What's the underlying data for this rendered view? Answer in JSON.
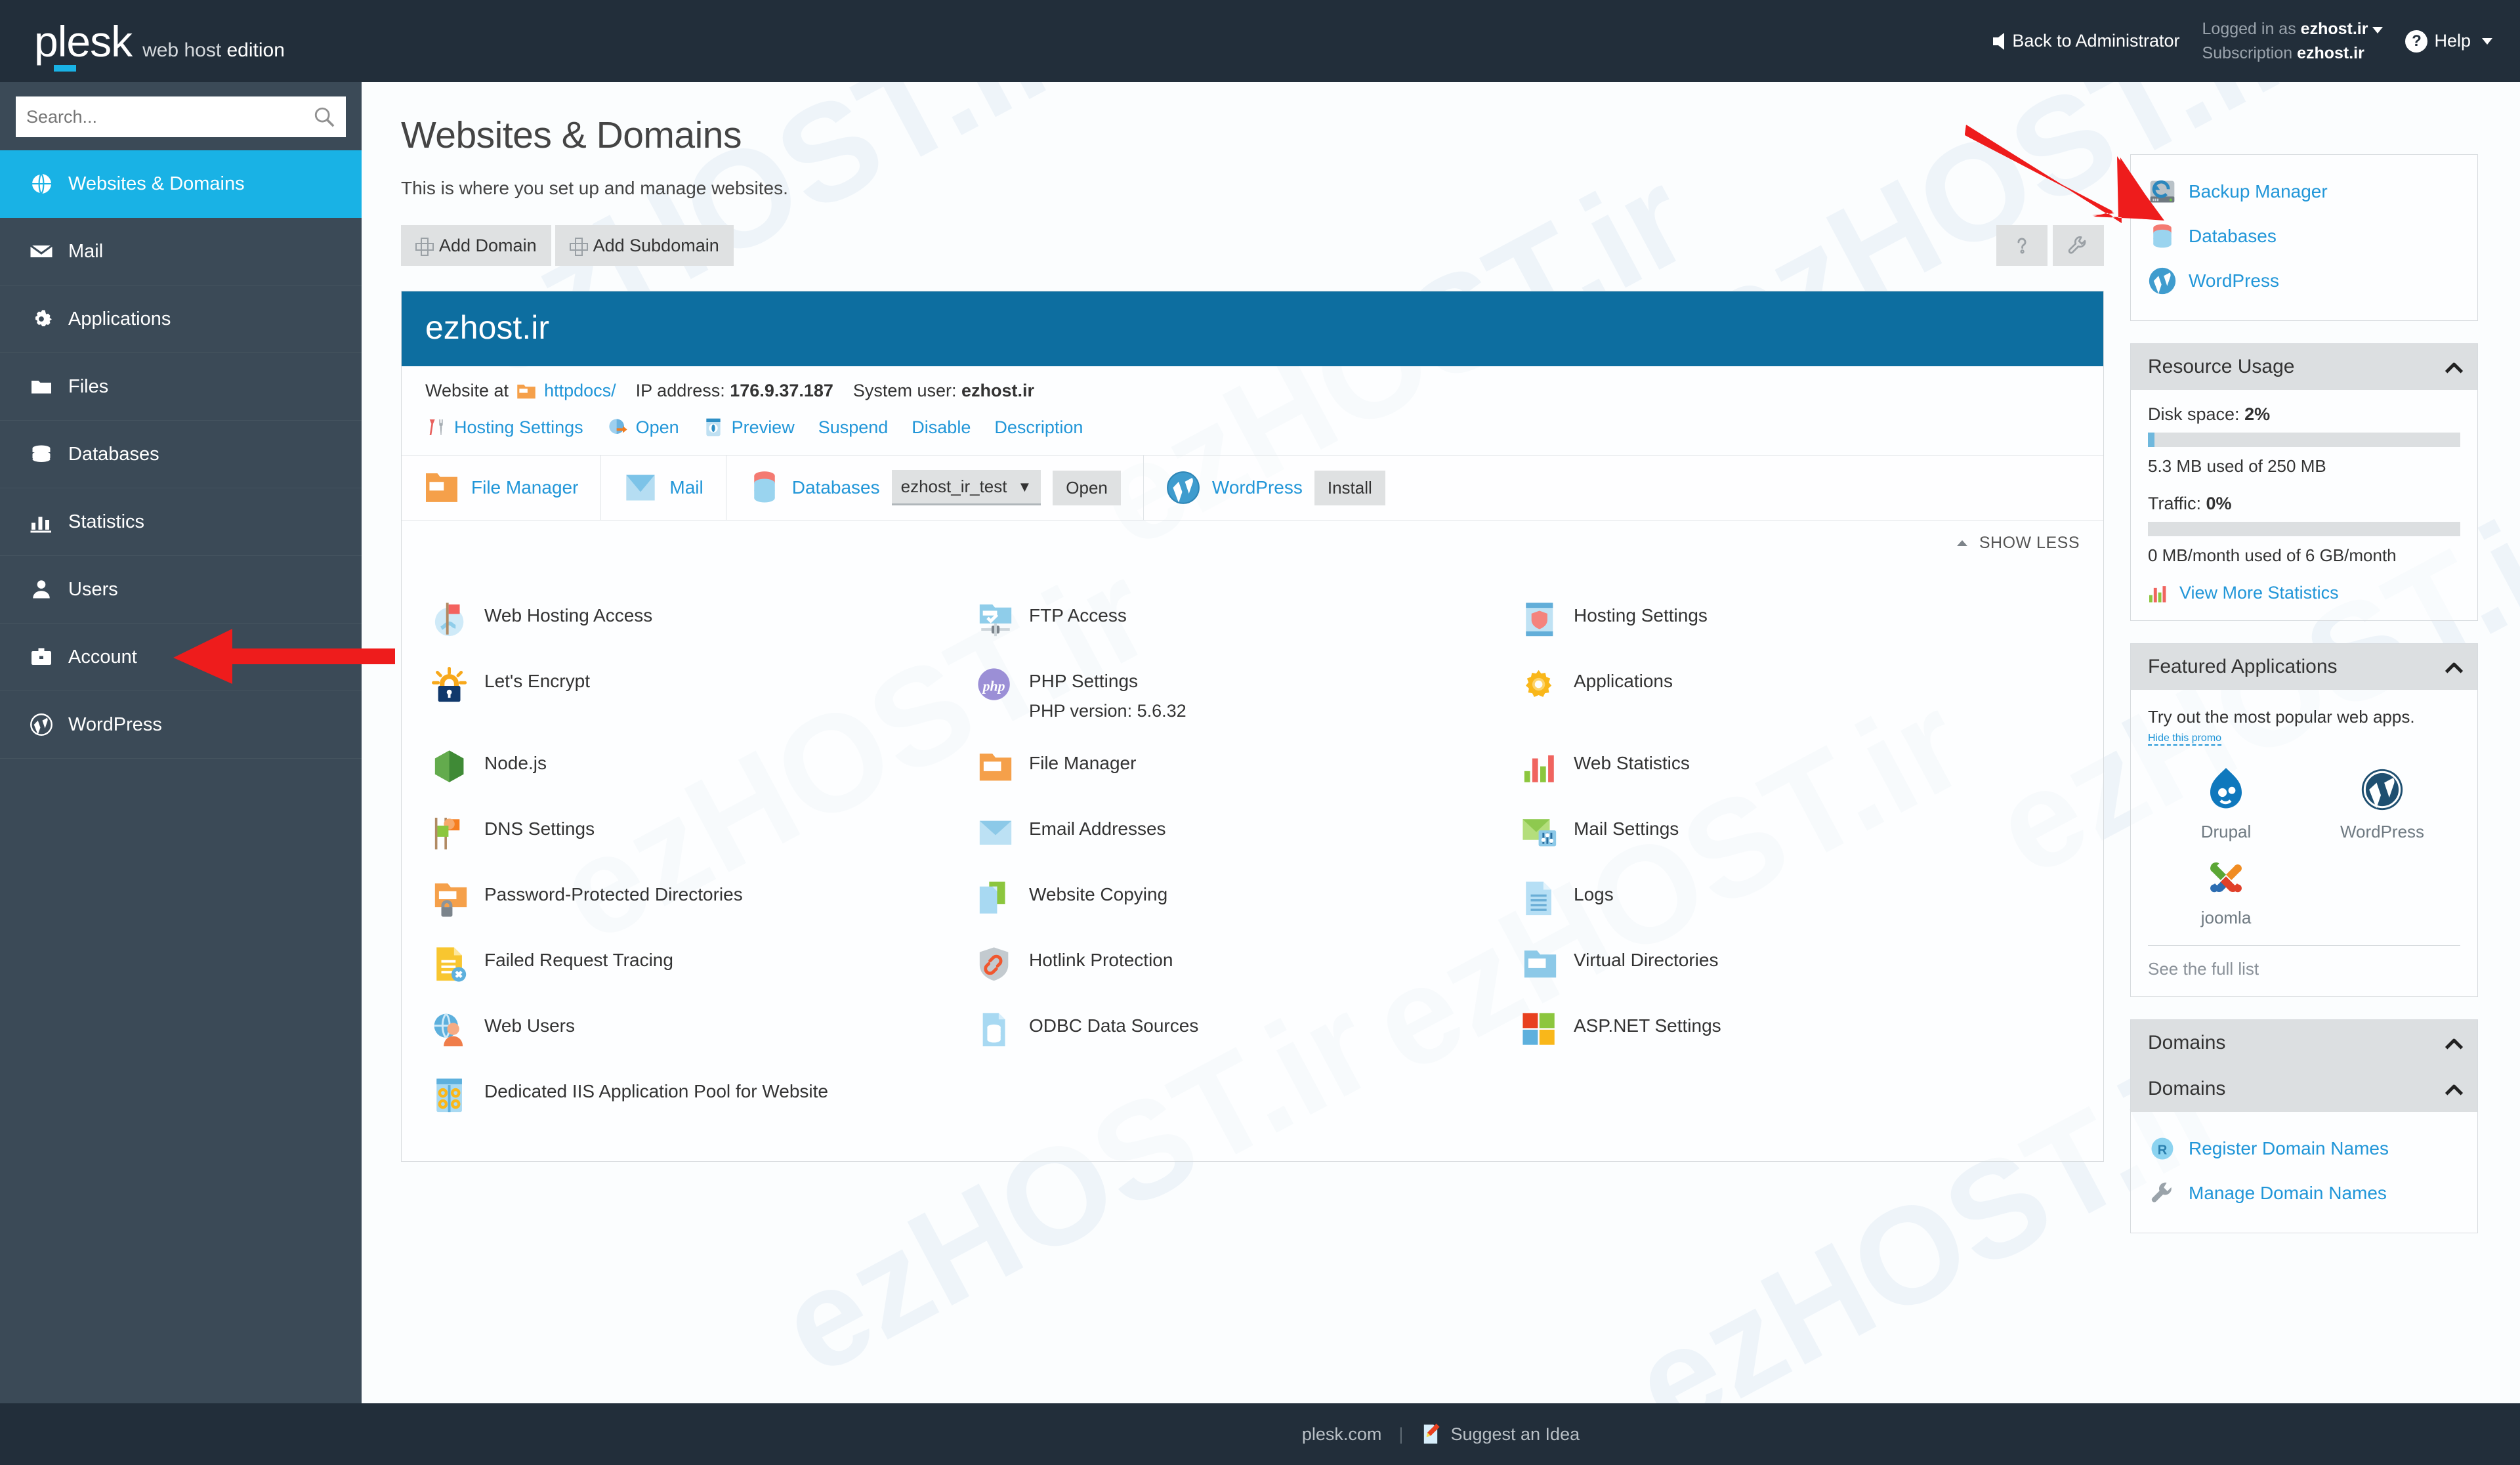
{
  "topbar": {
    "logo": "plesk",
    "logo_sub_1": "web host",
    "logo_sub_2": "edition",
    "back_to_admin": "Back to Administrator",
    "logged_in_label": "Logged in as",
    "logged_in_value": "ezhost.ir",
    "subscription_label": "Subscription",
    "subscription_value": "ezhost.ir",
    "help": "Help"
  },
  "sidebar": {
    "search_placeholder": "Search...",
    "items": [
      {
        "label": "Websites & Domains",
        "icon": "globe-icon",
        "active": true
      },
      {
        "label": "Mail",
        "icon": "envelope-icon",
        "active": false
      },
      {
        "label": "Applications",
        "icon": "gear-icon",
        "active": false
      },
      {
        "label": "Files",
        "icon": "folder-icon",
        "active": false
      },
      {
        "label": "Databases",
        "icon": "database-icon",
        "active": false
      },
      {
        "label": "Statistics",
        "icon": "bar-chart-icon",
        "active": false
      },
      {
        "label": "Users",
        "icon": "user-icon",
        "active": false
      },
      {
        "label": "Account",
        "icon": "briefcase-icon",
        "active": false
      },
      {
        "label": "WordPress",
        "icon": "wordpress-icon",
        "active": false
      }
    ]
  },
  "main": {
    "title": "Websites & Domains",
    "description": "This is where you set up and manage websites.",
    "add_domain": "Add Domain",
    "add_subdomain": "Add Subdomain",
    "help_button_icon": "question-mark-icon",
    "wrench_button_icon": "wrench-icon",
    "show_less": "SHOW LESS"
  },
  "domain": {
    "name": "ezhost.ir",
    "website_at_label": "Website at",
    "httpdocs": "httpdocs/",
    "ip_label": "IP address:",
    "ip_value": "176.9.37.187",
    "sysuser_label": "System user:",
    "sysuser_value": "ezhost.ir",
    "actions": [
      {
        "label": "Hosting Settings",
        "icon": "tools-icon",
        "link": true
      },
      {
        "label": "Open",
        "icon": "open-icon",
        "link": true
      },
      {
        "label": "Preview",
        "icon": "preview-icon",
        "link": true
      },
      {
        "label": "Suspend",
        "icon": "",
        "link": true
      },
      {
        "label": "Disable",
        "icon": "",
        "link": true
      },
      {
        "label": "Description",
        "icon": "",
        "link": true
      }
    ],
    "quick": {
      "file_manager": "File Manager",
      "mail": "Mail",
      "databases": "Databases",
      "db_selected": "ezhost_ir_test",
      "db_open": "Open",
      "wordpress": "WordPress",
      "wp_install": "Install"
    }
  },
  "grid": [
    {
      "label": "Web Hosting Access",
      "icon": "globe-flag-icon"
    },
    {
      "label": "FTP Access",
      "icon": "ftp-folder-icon"
    },
    {
      "label": "Hosting Settings",
      "icon": "shield-doc-icon"
    },
    {
      "label": "Let's Encrypt",
      "icon": "lock-sun-icon"
    },
    {
      "label": "PHP Settings",
      "icon": "php-icon",
      "note": "PHP version: 5.6.32"
    },
    {
      "label": "Applications",
      "icon": "gear-yellow-icon"
    },
    {
      "label": "Node.js",
      "icon": "nodejs-icon"
    },
    {
      "label": "File Manager",
      "icon": "folder-orange-icon"
    },
    {
      "label": "Web Statistics",
      "icon": "bars-icon"
    },
    {
      "label": "DNS Settings",
      "icon": "flags-icon"
    },
    {
      "label": "Email Addresses",
      "icon": "envelope-blue-icon"
    },
    {
      "label": "Mail Settings",
      "icon": "envelope-green-icon"
    },
    {
      "label": "Password-Protected Directories",
      "icon": "folder-lock-icon"
    },
    {
      "label": "Website Copying",
      "icon": "copy-icon"
    },
    {
      "label": "Logs",
      "icon": "log-doc-icon"
    },
    {
      "label": "Failed Request Tracing",
      "icon": "doc-error-icon"
    },
    {
      "label": "Hotlink Protection",
      "icon": "shield-link-icon"
    },
    {
      "label": "Virtual Directories",
      "icon": "folder-blue-icon"
    },
    {
      "label": "Web Users",
      "icon": "web-user-icon"
    },
    {
      "label": "ODBC Data Sources",
      "icon": "odbc-icon"
    },
    {
      "label": "ASP.NET Settings",
      "icon": "windows-icon"
    },
    {
      "label": "Dedicated IIS Application Pool for Website",
      "icon": "iis-pool-icon"
    }
  ],
  "side": {
    "quick_links": [
      {
        "label": "Backup Manager",
        "icon": "backup-icon"
      },
      {
        "label": "Databases",
        "icon": "database-icon"
      },
      {
        "label": "WordPress",
        "icon": "wordpress-icon"
      }
    ],
    "resource_usage": {
      "title": "Resource Usage",
      "disk_label": "Disk space:",
      "disk_value": "2%",
      "disk_percent": 2,
      "disk_sub": "5.3 MB used of 250 MB",
      "traffic_label": "Traffic:",
      "traffic_value": "0%",
      "traffic_percent": 0,
      "traffic_sub": "0 MB/month used of 6 GB/month",
      "view_more": "View More Statistics"
    },
    "featured": {
      "title": "Featured Applications",
      "promo": "Try out the most popular web apps.",
      "hide_promo": "Hide this promo",
      "apps": [
        {
          "name": "Drupal",
          "icon": "drupal-icon"
        },
        {
          "name": "WordPress",
          "icon": "wordpress-icon"
        },
        {
          "name": "joomla",
          "icon": "joomla-icon"
        }
      ],
      "see_full_list": "See the full list"
    },
    "domains": {
      "title_outer": "Domains",
      "title_inner": "Domains",
      "links": [
        {
          "label": "Register Domain Names",
          "icon": "register-r-icon"
        },
        {
          "label": "Manage Domain Names",
          "icon": "wrench-icon"
        }
      ]
    }
  },
  "footer": {
    "site": "plesk.com",
    "divider": "|",
    "suggest": "Suggest an Idea"
  },
  "watermark_text": "ezHOST.ir",
  "colors": {
    "accent": "#19b2e5",
    "link": "#2196d8",
    "topbar": "#222e3a",
    "sidebar": "#3b4a57",
    "domain_header": "#0d6ea0",
    "arrow_red": "#ee1c1c"
  }
}
